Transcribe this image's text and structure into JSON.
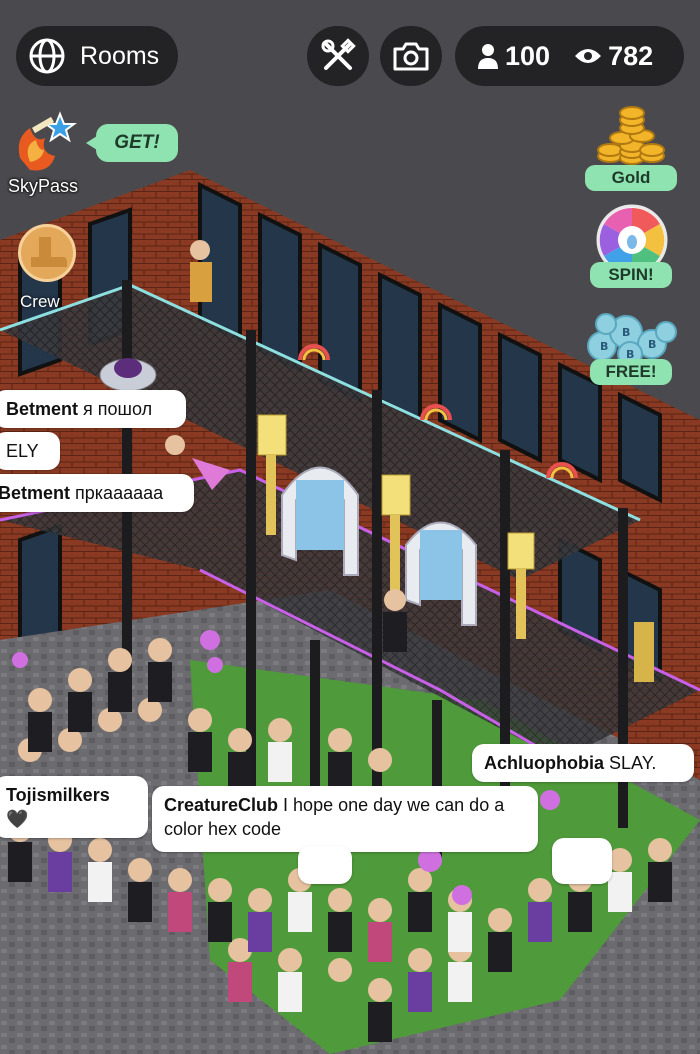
{
  "topbar": {
    "rooms_label": "Rooms",
    "user_count": "100",
    "viewer_count": "782"
  },
  "left_panel": {
    "skypass_label": "SkyPass",
    "get_label": "GET!",
    "crew_label": "Crew"
  },
  "right_panel": {
    "gold_label": "Gold",
    "spin_label": "SPIN!",
    "free_label": "FREE!"
  },
  "chat": {
    "m1_user": "Betment",
    "m1_text": "я пошол",
    "m2_text": "ELY",
    "m3_user": "Betment",
    "m3_text": "пркаааааа",
    "m4_user": "Achluophobia",
    "m4_text": "SLAY.",
    "m5_user": "Tojismilkers",
    "m5_text": "🖤",
    "m6_user": "CreatureClub",
    "m6_text": "I hope one day we can do a color hex code"
  },
  "colors": {
    "accent_green": "#8fe3b0",
    "pill_bg": "#232325",
    "brick": "#8a3a22",
    "floor_grass": "#4f9a3a",
    "neon_purple": "#c860e8",
    "neon_cyan": "#8ee0e0"
  },
  "icons": [
    "globe-icon",
    "tools-icon",
    "camera-icon",
    "person-icon",
    "eye-icon",
    "skypass-icon",
    "crew-icon",
    "gold-coins-icon",
    "spin-wheel-icon",
    "bubbles-icon"
  ]
}
